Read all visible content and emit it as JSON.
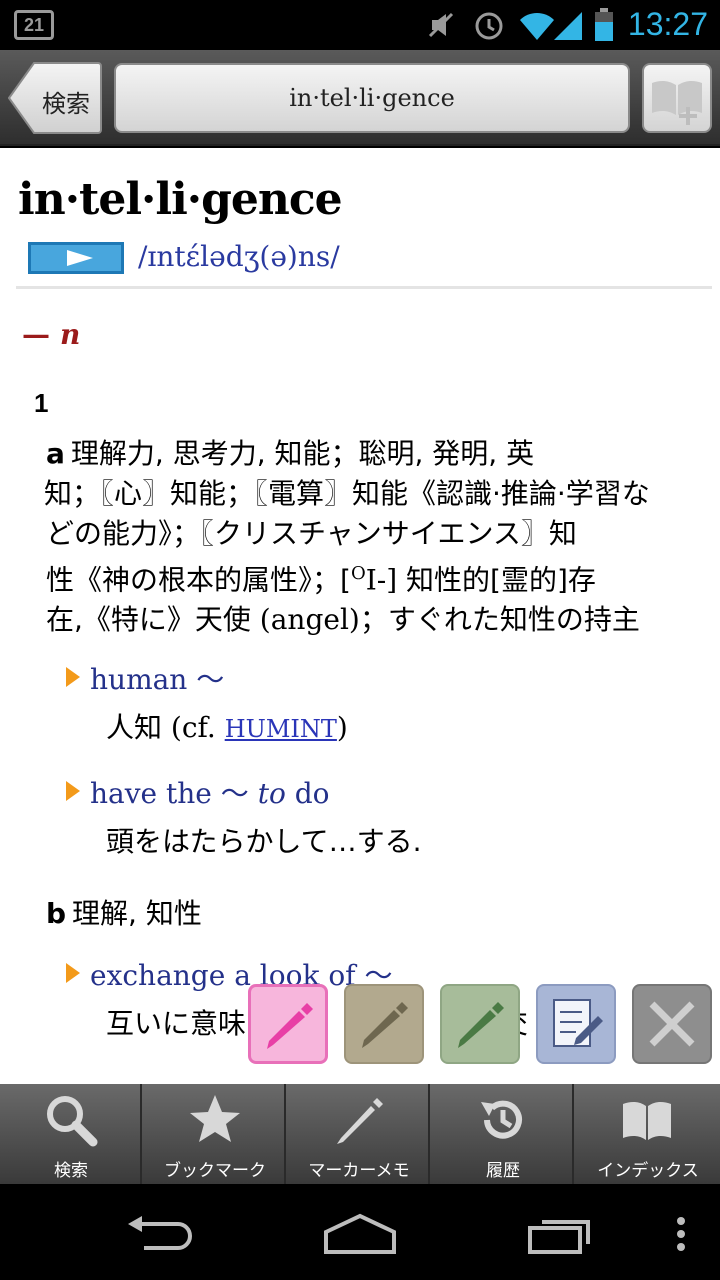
{
  "status_bar": {
    "notification_count": "21",
    "time": "13:27"
  },
  "toolbar": {
    "back_label": "検索",
    "title": "in·tel·li·gence"
  },
  "entry": {
    "headword": "in·tel·li·gence",
    "pronunciation": "/ɪntɛ́lədʒ(ə)ns/",
    "pos_dash": "—",
    "pos": "n",
    "sense_number": "1",
    "sense_a": {
      "letter": "a",
      "line1": "理解力, 思考力, 知能；聡明, 発明, 英",
      "line2": "知；〖心〗知能；〖電算〗知能《認識·推論·学習な",
      "line3": "どの能力》；〖クリスチャンサイエンス〗知",
      "line4_a": "性《神の根本的属性》；[",
      "line4_sup": "O",
      "line4_b": "I-]",
      "line4_c": " 知性的[霊的]存",
      "line5_a": "在,《特に》天使",
      "line5_b": " (angel)",
      "line5_c": "；すぐれた知性の持主"
    },
    "examples_a": [
      {
        "phrase": "human 〜",
        "translation": "人知",
        "cf": " (cf. ",
        "link": "HUMINT",
        "close": ")"
      },
      {
        "phrase_a": "have the 〜 ",
        "phrase_i": "to",
        "phrase_b": " do",
        "translation": "頭をはたらかして…する."
      }
    ],
    "sense_b": {
      "letter": "b",
      "text": "理解, 知性"
    },
    "examples_b": [
      {
        "phrase": "exchange a look of 〜",
        "translation_a": "互いに意味",
        "translation_b": "け",
        "translation_c": "交",
        "translation_d": "."
      }
    ]
  },
  "palette": {
    "colors": {
      "pink": "#f7b6dc",
      "khaki": "#b2a98e",
      "green": "#a7bc9a",
      "memo": "#a8b6d6",
      "close": "#8e8e8e"
    }
  },
  "tabs": [
    {
      "label": "検索",
      "icon": "search-icon"
    },
    {
      "label": "ブックマーク",
      "icon": "star-icon"
    },
    {
      "label": "マーカーメモ",
      "icon": "pencil-icon"
    },
    {
      "label": "履歴",
      "icon": "history-icon"
    },
    {
      "label": "インデックス",
      "icon": "book-icon"
    }
  ]
}
